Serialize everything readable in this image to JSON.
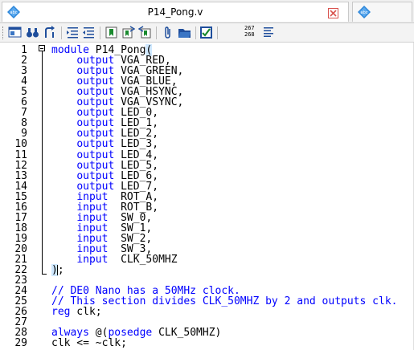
{
  "tabs": [
    {
      "title": "P14_Pong.v",
      "icon": "abc-file-icon",
      "active": true
    },
    {
      "title": "",
      "icon": "abc-file-icon",
      "active": false
    }
  ],
  "toolbar": {
    "word_count_top": "267",
    "word_count_bottom": "268",
    "items": [
      "open-file-icon",
      "binoculars-icon",
      "goto-icon",
      "indent-icon",
      "unindent-icon",
      "bookmark-icon",
      "bookmark-next-icon",
      "bookmark-prev-icon",
      "attach-icon",
      "folder-icon",
      "check-icon",
      "word-count-icon",
      "list-icon"
    ]
  },
  "colors": {
    "keyword": "#0000ff",
    "comment": "#0000ff",
    "identifier": "#000000",
    "brace_highlight": "#cfe8ff"
  },
  "editor": {
    "lines": [
      {
        "n": "1",
        "segs": [
          {
            "t": "module",
            "c": "kw"
          },
          {
            "t": " P14_Pong",
            "c": "id"
          },
          {
            "t": "(",
            "c": "brace"
          }
        ]
      },
      {
        "n": "2",
        "segs": [
          {
            "t": "    ",
            "c": "id"
          },
          {
            "t": "output",
            "c": "kw"
          },
          {
            "t": " VGA_RED,",
            "c": "id"
          }
        ]
      },
      {
        "n": "3",
        "segs": [
          {
            "t": "    ",
            "c": "id"
          },
          {
            "t": "output",
            "c": "kw"
          },
          {
            "t": " VGA_GREEN,",
            "c": "id"
          }
        ]
      },
      {
        "n": "4",
        "segs": [
          {
            "t": "    ",
            "c": "id"
          },
          {
            "t": "output",
            "c": "kw"
          },
          {
            "t": " VGA_BLUE,",
            "c": "id"
          }
        ]
      },
      {
        "n": "5",
        "segs": [
          {
            "t": "    ",
            "c": "id"
          },
          {
            "t": "output",
            "c": "kw"
          },
          {
            "t": " VGA_HSYNC,",
            "c": "id"
          }
        ]
      },
      {
        "n": "6",
        "segs": [
          {
            "t": "    ",
            "c": "id"
          },
          {
            "t": "output",
            "c": "kw"
          },
          {
            "t": " VGA_VSYNC,",
            "c": "id"
          }
        ]
      },
      {
        "n": "7",
        "segs": [
          {
            "t": "    ",
            "c": "id"
          },
          {
            "t": "output",
            "c": "kw"
          },
          {
            "t": " LED_0,",
            "c": "id"
          }
        ]
      },
      {
        "n": "8",
        "segs": [
          {
            "t": "    ",
            "c": "id"
          },
          {
            "t": "output",
            "c": "kw"
          },
          {
            "t": " LED_1,",
            "c": "id"
          }
        ]
      },
      {
        "n": "9",
        "segs": [
          {
            "t": "    ",
            "c": "id"
          },
          {
            "t": "output",
            "c": "kw"
          },
          {
            "t": " LED_2,",
            "c": "id"
          }
        ]
      },
      {
        "n": "10",
        "segs": [
          {
            "t": "    ",
            "c": "id"
          },
          {
            "t": "output",
            "c": "kw"
          },
          {
            "t": " LED_3,",
            "c": "id"
          }
        ]
      },
      {
        "n": "11",
        "segs": [
          {
            "t": "    ",
            "c": "id"
          },
          {
            "t": "output",
            "c": "kw"
          },
          {
            "t": " LED_4,",
            "c": "id"
          }
        ]
      },
      {
        "n": "12",
        "segs": [
          {
            "t": "    ",
            "c": "id"
          },
          {
            "t": "output",
            "c": "kw"
          },
          {
            "t": " LED_5,",
            "c": "id"
          }
        ]
      },
      {
        "n": "13",
        "segs": [
          {
            "t": "    ",
            "c": "id"
          },
          {
            "t": "output",
            "c": "kw"
          },
          {
            "t": " LED_6,",
            "c": "id"
          }
        ]
      },
      {
        "n": "14",
        "segs": [
          {
            "t": "    ",
            "c": "id"
          },
          {
            "t": "output",
            "c": "kw"
          },
          {
            "t": " LED_7,",
            "c": "id"
          }
        ]
      },
      {
        "n": "15",
        "segs": [
          {
            "t": "    ",
            "c": "id"
          },
          {
            "t": "input",
            "c": "kw"
          },
          {
            "t": "  ROT_A,",
            "c": "id"
          }
        ]
      },
      {
        "n": "16",
        "segs": [
          {
            "t": "    ",
            "c": "id"
          },
          {
            "t": "input",
            "c": "kw"
          },
          {
            "t": "  ROT_B,",
            "c": "id"
          }
        ]
      },
      {
        "n": "17",
        "segs": [
          {
            "t": "    ",
            "c": "id"
          },
          {
            "t": "input",
            "c": "kw"
          },
          {
            "t": "  SW_0,",
            "c": "id"
          }
        ]
      },
      {
        "n": "18",
        "segs": [
          {
            "t": "    ",
            "c": "id"
          },
          {
            "t": "input",
            "c": "kw"
          },
          {
            "t": "  SW_1,",
            "c": "id"
          }
        ]
      },
      {
        "n": "19",
        "segs": [
          {
            "t": "    ",
            "c": "id"
          },
          {
            "t": "input",
            "c": "kw"
          },
          {
            "t": "  SW_2,",
            "c": "id"
          }
        ]
      },
      {
        "n": "20",
        "segs": [
          {
            "t": "    ",
            "c": "id"
          },
          {
            "t": "input",
            "c": "kw"
          },
          {
            "t": "  SW_3,",
            "c": "id"
          }
        ]
      },
      {
        "n": "21",
        "segs": [
          {
            "t": "    ",
            "c": "id"
          },
          {
            "t": "input",
            "c": "kw"
          },
          {
            "t": "  CLK_50MHZ",
            "c": "id"
          }
        ]
      },
      {
        "n": "22",
        "segs": [
          {
            "t": ")",
            "c": "brace"
          },
          {
            "t": ";",
            "c": "id"
          }
        ]
      },
      {
        "n": "23",
        "segs": []
      },
      {
        "n": "24",
        "segs": [
          {
            "t": "// DE0 Nano has a 50MHz clock.",
            "c": "cm"
          }
        ]
      },
      {
        "n": "25",
        "segs": [
          {
            "t": "// This section divides CLK_50MHZ by 2 and outputs clk.",
            "c": "cm"
          }
        ]
      },
      {
        "n": "26",
        "segs": [
          {
            "t": "reg",
            "c": "kw"
          },
          {
            "t": " clk;",
            "c": "id"
          }
        ]
      },
      {
        "n": "27",
        "segs": []
      },
      {
        "n": "28",
        "segs": [
          {
            "t": "always",
            "c": "kw"
          },
          {
            "t": " @(",
            "c": "id"
          },
          {
            "t": "posedge",
            "c": "kw"
          },
          {
            "t": " CLK_50MHZ)",
            "c": "id"
          }
        ]
      },
      {
        "n": "29",
        "segs": [
          {
            "t": "clk <= ~clk;",
            "c": "id"
          }
        ]
      }
    ]
  }
}
